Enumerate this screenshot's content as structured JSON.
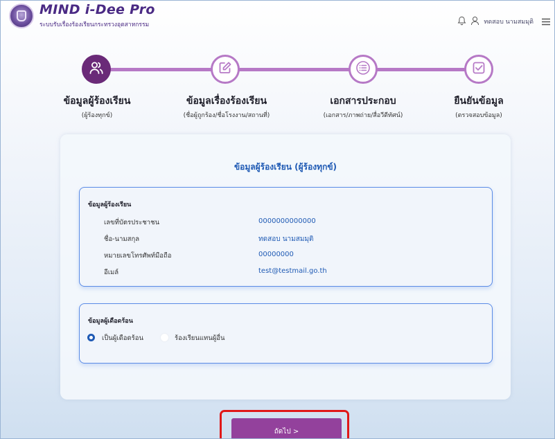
{
  "header": {
    "app_title": "MIND i-Dee Pro",
    "app_subtitle": "ระบบรับเรื่องร้องเรียนกระทรวงอุตสาหกรรม",
    "user_name": "ทดสอบ นามสมมุติ",
    "icons": [
      "bell-icon",
      "user-icon",
      "menu-icon"
    ]
  },
  "stepper": {
    "active_index": 0,
    "steps": [
      {
        "title": "ข้อมูลผู้ร้องเรียน",
        "subtitle": "(ผู้ร้องทุกข์)",
        "icon": "people-icon"
      },
      {
        "title": "ข้อมูลเรื่องร้องเรียน",
        "subtitle": "(ชื่อผู้ถูกร้อง/ชื่อโรงงาน/สถานที่)",
        "icon": "edit-icon"
      },
      {
        "title": "เอกสารประกอบ",
        "subtitle": "(เอกสาร/ภาพถ่าย/สื่อวีดีทัศน์)",
        "icon": "list-icon"
      },
      {
        "title": "ยืนยันข้อมูล",
        "subtitle": "(ตรวจสอบข้อมูล)",
        "icon": "check-square-icon"
      }
    ]
  },
  "main": {
    "title": "ข้อมูลผู้ร้องเรียน (ผู้ร้องทุกข์)",
    "complainant": {
      "heading": "ข้อมูลผู้ร้องเรียน",
      "rows": [
        {
          "label": "เลขที่บัตรประชาชน",
          "value": "0000000000000"
        },
        {
          "label": "ชื่อ-นามสกุล",
          "value": "ทดสอบ นามสมมุติ"
        },
        {
          "label": "หมายเลขโทรศัพท์มือถือ",
          "value": "00000000"
        },
        {
          "label": "อีเมล์",
          "value": "test@testmail.go.th"
        }
      ]
    },
    "victim": {
      "heading": "ข้อมูลผู้เดือดร้อน",
      "options": [
        {
          "label": "เป็นผู้เดือดร้อน",
          "checked": true
        },
        {
          "label": "ร้องเรียนแทนผู้อื่น",
          "checked": false
        }
      ]
    }
  },
  "footer": {
    "next_label": "ถัดไป >"
  },
  "colors": {
    "brand_purple": "#4a2a84",
    "step_active": "#6a2a78",
    "step_line": "#b679c6",
    "accent_blue": "#1f5ab4",
    "button": "#93419c",
    "highlight_red": "#e01818"
  }
}
